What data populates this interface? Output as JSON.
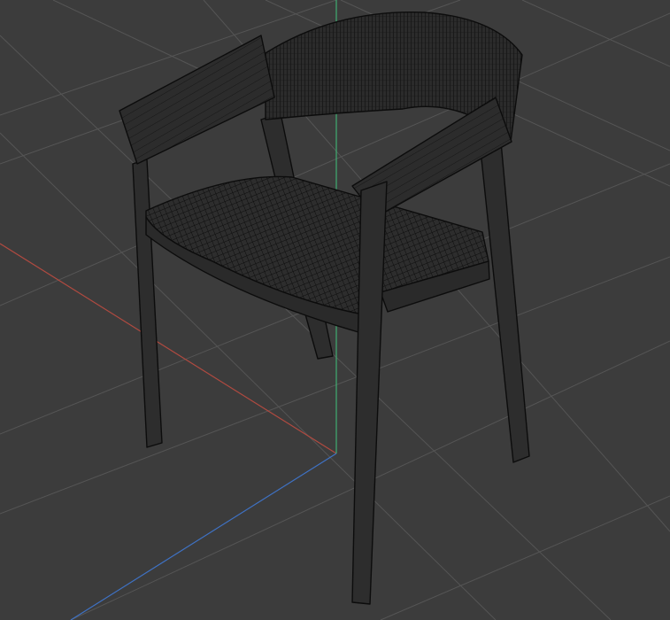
{
  "viewport": {
    "background_color": "#3c3c3c",
    "grid_color": "#555555",
    "axis_colors": {
      "x": "#b04a40",
      "y": "#3fae72",
      "z": "#3f72c4"
    },
    "model": {
      "name": "armchair",
      "display_mode": "wireframe",
      "fill_color": "#2c2c2c",
      "wire_color": "#0c0c0c"
    }
  }
}
